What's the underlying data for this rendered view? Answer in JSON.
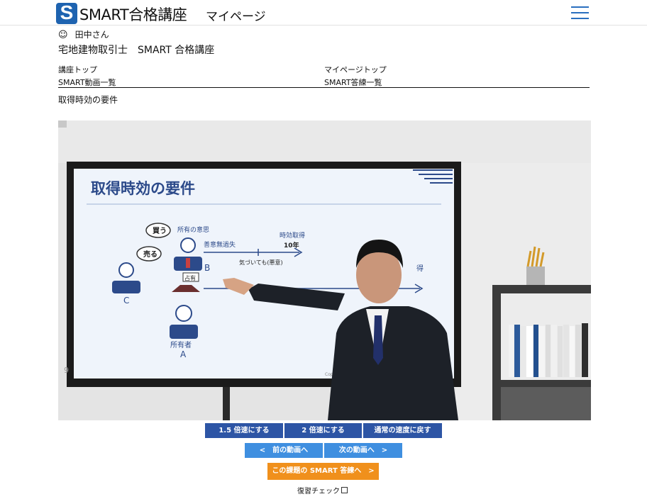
{
  "header": {
    "logo_letter": "S",
    "brand": "SMART合格講座",
    "page_name": "マイページ"
  },
  "user": {
    "icon": "smiley-icon",
    "name": "田中さん"
  },
  "course_title": "宅地建物取引士　SMART 合格講座",
  "nav": {
    "course_top": "講座トップ",
    "mypage_top": "マイページトップ",
    "video_list": "SMART動画一覧",
    "answer_list": "SMART答練一覧"
  },
  "lesson_title": "取得時効の要件",
  "slide": {
    "title": "取得時効の要件",
    "buy": "買う",
    "sell": "売る",
    "intent": "所有の意思",
    "good_faith": "善意無過失",
    "acquire": "時効取得",
    "ten_years": "10年",
    "noticed": "気づいても(悪意)",
    "occupy": "占有",
    "label_b": "B",
    "label_c": "C",
    "owner": "所有者",
    "label_a": "A",
    "partial": "得",
    "copyright": "Copyright"
  },
  "speed": {
    "x15": "1.5 倍速にする",
    "x2": "2 倍速にする",
    "normal": "通常の速度に戻す"
  },
  "nav_video": {
    "prev": "<　前の動画へ",
    "next": "次の動画へ　>"
  },
  "answer_button": "この課題の SMART 答練へ　>",
  "review_label": "復習チェック",
  "colors": {
    "brand_blue": "#1e63b0",
    "speed_button": "#2d55a5",
    "nav_button": "#3f8fe0",
    "answer_button": "#f0901c"
  }
}
